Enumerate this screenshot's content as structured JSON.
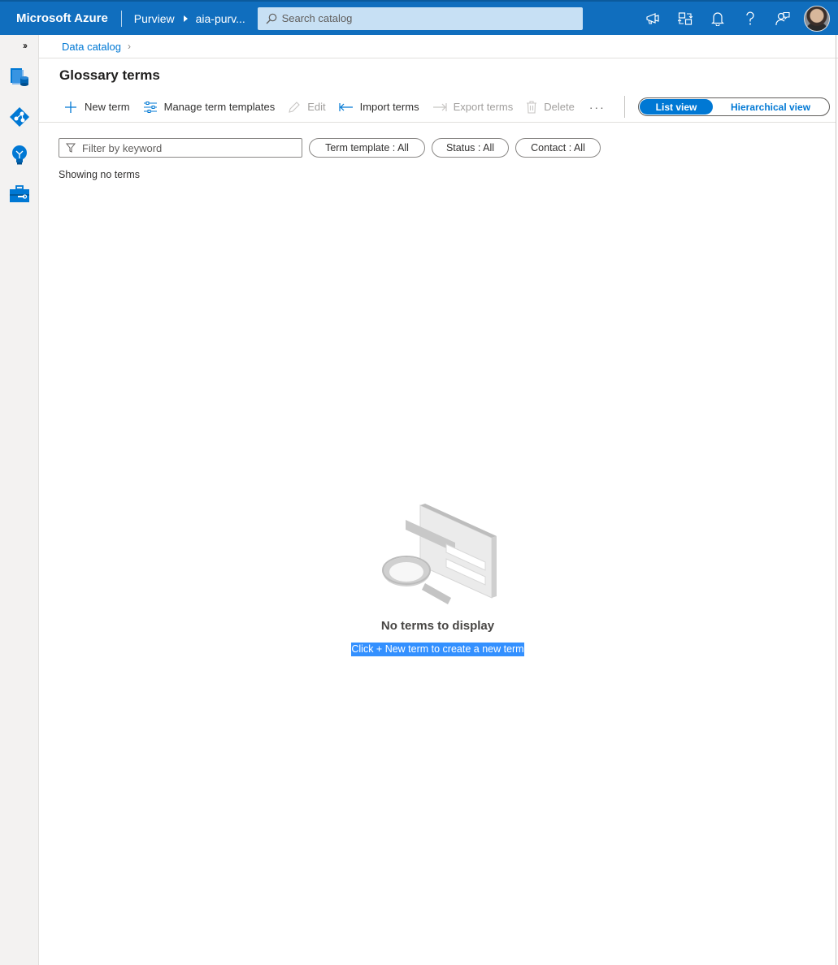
{
  "topbar": {
    "brand": "Microsoft Azure",
    "service": "Purview",
    "account": "aia-purv...",
    "search_placeholder": "Search catalog",
    "icons": [
      "feedback-megaphone-icon",
      "directory-switch-icon",
      "notification-bell-icon",
      "help-icon",
      "feedback-person-icon"
    ]
  },
  "breadcrumb": {
    "items": [
      "Data catalog"
    ]
  },
  "page": {
    "title": "Glossary terms"
  },
  "commands": {
    "new_term": "New term",
    "manage_templates": "Manage term templates",
    "edit": "Edit",
    "import_terms": "Import terms",
    "export_terms": "Export terms",
    "delete": "Delete",
    "more": "···"
  },
  "view_toggle": {
    "list": "List view",
    "hierarchical": "Hierarchical view",
    "selected": "List view"
  },
  "filters": {
    "keyword_placeholder": "Filter by keyword",
    "term_template": "Term template : All",
    "status": "Status : All",
    "contact": "Contact : All"
  },
  "results": {
    "summary": "Showing no terms"
  },
  "empty_state": {
    "title": "No terms to display",
    "subtitle": "Click + New term to create a new term"
  },
  "colors": {
    "topbar": "#106ebe",
    "accent": "#0078d4",
    "selection": "#3390ff"
  }
}
